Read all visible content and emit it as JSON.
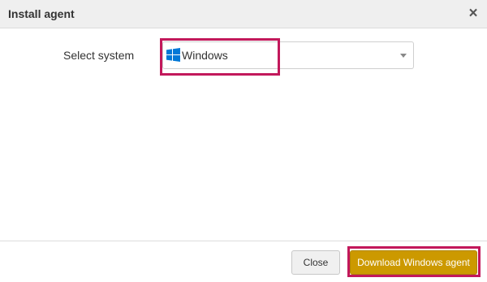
{
  "dialog": {
    "title": "Install agent",
    "close_symbol": "×"
  },
  "form": {
    "label": "Select system",
    "selected_system": "Windows",
    "selected_icon": "windows-logo-icon",
    "dropdown_icon": "caret-down-icon"
  },
  "footer": {
    "close_label": "Close",
    "download_label": "Download Windows agent"
  },
  "colors": {
    "accent": "#cc9900",
    "highlight": "#c2185b",
    "windows_blue": "#0078d7"
  }
}
